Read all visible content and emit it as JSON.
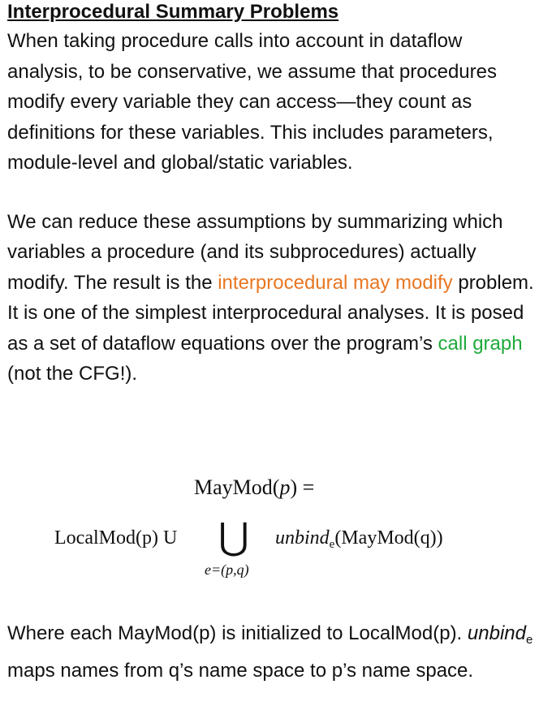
{
  "title": "Interprocedural Summary Problems",
  "para1": {
    "text": "When taking procedure calls into account in dataflow analysis, to be conservative, we assume that procedures modify every variable they can access—they count as definitions for these variables.  This includes parameters, module-level and global/static variables."
  },
  "para2": {
    "text_a": "We can reduce these assumptions by summarizing which variables a procedure (and its subprocedures) actually modify.  The result is the ",
    "highlight_orange": "interprocedural may modify",
    "text_b": " problem.  It is one of the simplest interprocedural analyses.  It is posed as a set of dataflow equations over the program’s ",
    "highlight_green": "call graph",
    "text_c": " (not the CFG!)."
  },
  "formula": {
    "lhs_name": "MayMod(",
    "lhs_var": "p",
    "lhs_close": ") =",
    "local": "LocalMod(p) U",
    "union_symbol": "⋃",
    "union_sub": "e=(p,q)",
    "unbind": "unbind",
    "unbind_sub": "e",
    "rhs": "(MayMod(q))"
  },
  "para3": {
    "text_a": "Where each MayMod(p) is initialized to LocalMod(p).  ",
    "unbind": "unbind",
    "unbind_sub": "e",
    "text_b": " maps names from q’s name space to p’s name space."
  },
  "colors": {
    "orange": "#E87722",
    "green": "#1FAA3A"
  }
}
